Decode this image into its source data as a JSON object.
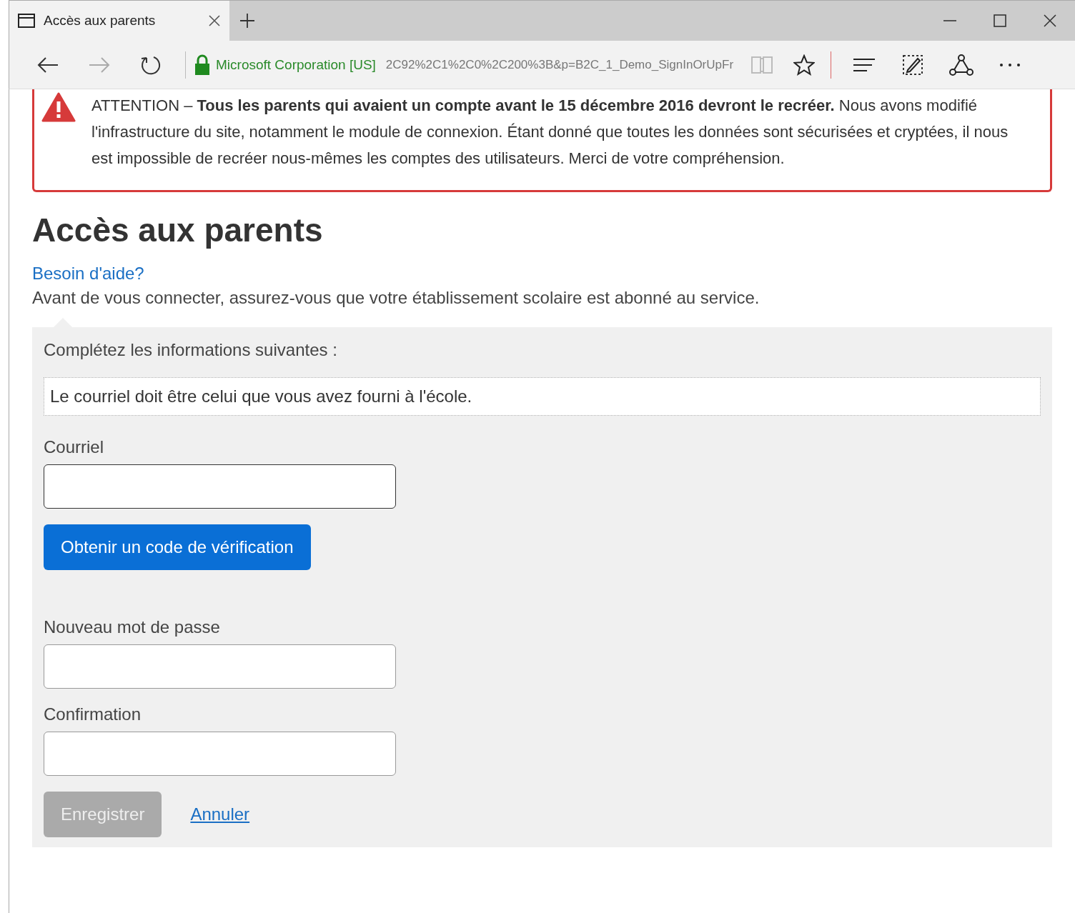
{
  "browser": {
    "tab_title": "Accès aux parents",
    "site_identity": "Microsoft Corporation [US]",
    "url": "2C92%2C1%2C0%2C200%3B&p=B2C_1_Demo_SignInOrUpFr"
  },
  "alert": {
    "text": "ATTENTION – **Tous les parents qui avaient un compte avant le 15 décembre 2016 devront le recréer.** Nous avons modifié l'infrastructure du site, notamment le module de connexion. Étant donné que toutes les données sont sécurisées et cryptées, il nous est impossible de recréer nous-mêmes les comptes des utilisateurs. Merci de votre compréhension."
  },
  "heading": "Accès aux parents",
  "help_link": "Besoin d'aide?",
  "intro": "Avant de vous connecter, assurez-vous que votre établissement scolaire est abonné au service.",
  "form": {
    "instructions": "Complétez les informations suivantes :",
    "notice": "Le courriel doit être celui que vous avez fourni à l'école.",
    "email": {
      "label": "Courriel"
    },
    "verify_button": "Obtenir un code de vérification",
    "password_fields": [
      {
        "label": "Nouveau mot de passe"
      },
      {
        "label": "Confirmation"
      }
    ],
    "save_button": {
      "label": "Enregistrer",
      "disabled": true
    },
    "cancel_link": "Annuler"
  }
}
